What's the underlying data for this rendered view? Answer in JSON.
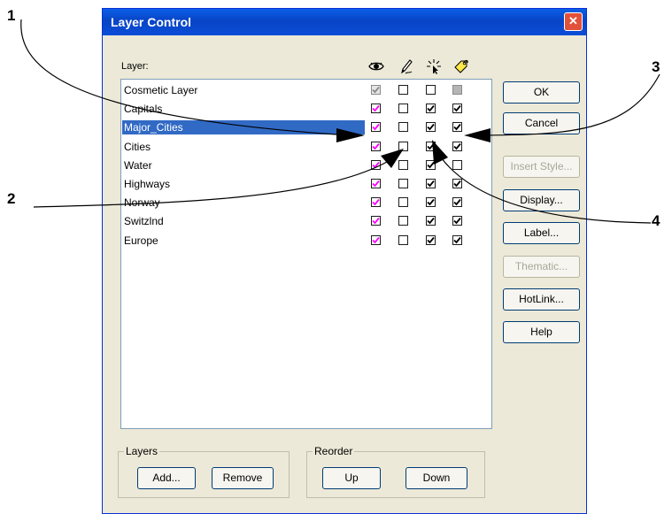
{
  "dialog": {
    "title": "Layer Control",
    "layer_label": "Layer:",
    "columns": [
      "eye-icon",
      "pencil-icon",
      "pointer-icon",
      "label-tag-icon"
    ]
  },
  "layers": [
    {
      "name": "Cosmetic Layer",
      "visible": "grey-checked",
      "editable": false,
      "selectable": false,
      "labels": "grey"
    },
    {
      "name": "Capitals",
      "visible": "checked",
      "editable": false,
      "selectable": true,
      "labels": "checked"
    },
    {
      "name": "Major_Cities",
      "visible": "checked",
      "editable": false,
      "selectable": true,
      "labels": "checked",
      "selected": true
    },
    {
      "name": "Cities",
      "visible": "checked",
      "editable": false,
      "selectable": true,
      "labels": "checked"
    },
    {
      "name": "Water",
      "visible": "checked",
      "editable": false,
      "selectable": true,
      "labels": "unchecked"
    },
    {
      "name": "Highways",
      "visible": "checked",
      "editable": false,
      "selectable": true,
      "labels": "checked"
    },
    {
      "name": "Norway",
      "visible": "checked",
      "editable": false,
      "selectable": true,
      "labels": "checked"
    },
    {
      "name": "Switzlnd",
      "visible": "checked",
      "editable": false,
      "selectable": true,
      "labels": "checked"
    },
    {
      "name": "Europe",
      "visible": "checked",
      "editable": false,
      "selectable": true,
      "labels": "checked"
    }
  ],
  "buttons": {
    "ok": "OK",
    "cancel": "Cancel",
    "insert_style": "Insert Style...",
    "display": "Display...",
    "label": "Label...",
    "thematic": "Thematic...",
    "hotlink": "HotLink...",
    "help": "Help"
  },
  "groups": {
    "layers": {
      "title": "Layers",
      "add": "Add...",
      "remove": "Remove"
    },
    "reorder": {
      "title": "Reorder",
      "up": "Up",
      "down": "Down"
    }
  },
  "callouts": [
    "1",
    "2",
    "3",
    "4"
  ],
  "colors": {
    "title_bar": "#0a4ed6",
    "selection": "#316ac5",
    "visible_check": "#ff00ff",
    "dialog_bg": "#ece9d8",
    "close_button": "#e2513a"
  }
}
